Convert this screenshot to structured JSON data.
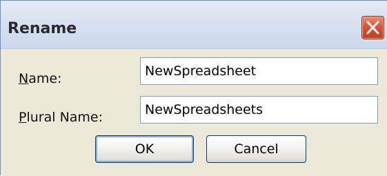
{
  "dialog": {
    "title": "Rename",
    "close_icon": "close-icon",
    "close_color": "#d9512e"
  },
  "fields": {
    "name": {
      "label_mnemonic": "N",
      "label_rest": "ame:",
      "value": "NewSpreadsheet"
    },
    "plural_name": {
      "label_mnemonic": "P",
      "label_rest": "lural Name:",
      "value": "NewSpreadsheets"
    }
  },
  "buttons": {
    "ok_label": "OK",
    "cancel_label": "Cancel"
  }
}
